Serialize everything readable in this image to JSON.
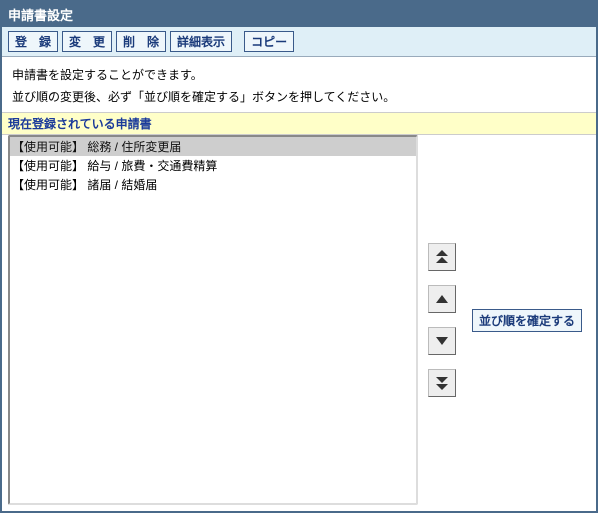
{
  "title": "申請書設定",
  "toolbar": {
    "register": "登　録",
    "edit": "変　更",
    "delete": "削　除",
    "detail": "詳細表示",
    "copy": "コピー"
  },
  "message1": "申請書を設定することができます。",
  "message2": "並び順の変更後、必ず「並び順を確定する」ボタンを押してください。",
  "list_title": "現在登録されている申請書",
  "items": [
    "【使用可能】 総務 / 住所変更届",
    "【使用可能】 給与 / 旅費・交通費精算",
    "【使用可能】 諸届 / 結婚届"
  ],
  "confirm_label": "並び順を確定する"
}
